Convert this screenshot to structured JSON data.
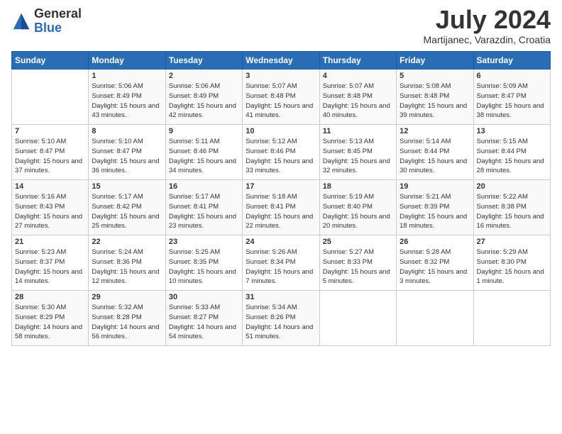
{
  "logo": {
    "general": "General",
    "blue": "Blue"
  },
  "title": "July 2024",
  "subtitle": "Martijanec, Varazdin, Croatia",
  "days_header": [
    "Sunday",
    "Monday",
    "Tuesday",
    "Wednesday",
    "Thursday",
    "Friday",
    "Saturday"
  ],
  "weeks": [
    [
      {
        "num": "",
        "sunrise": "",
        "sunset": "",
        "daylight": ""
      },
      {
        "num": "1",
        "sunrise": "Sunrise: 5:06 AM",
        "sunset": "Sunset: 8:49 PM",
        "daylight": "Daylight: 15 hours and 43 minutes."
      },
      {
        "num": "2",
        "sunrise": "Sunrise: 5:06 AM",
        "sunset": "Sunset: 8:49 PM",
        "daylight": "Daylight: 15 hours and 42 minutes."
      },
      {
        "num": "3",
        "sunrise": "Sunrise: 5:07 AM",
        "sunset": "Sunset: 8:48 PM",
        "daylight": "Daylight: 15 hours and 41 minutes."
      },
      {
        "num": "4",
        "sunrise": "Sunrise: 5:07 AM",
        "sunset": "Sunset: 8:48 PM",
        "daylight": "Daylight: 15 hours and 40 minutes."
      },
      {
        "num": "5",
        "sunrise": "Sunrise: 5:08 AM",
        "sunset": "Sunset: 8:48 PM",
        "daylight": "Daylight: 15 hours and 39 minutes."
      },
      {
        "num": "6",
        "sunrise": "Sunrise: 5:09 AM",
        "sunset": "Sunset: 8:47 PM",
        "daylight": "Daylight: 15 hours and 38 minutes."
      }
    ],
    [
      {
        "num": "7",
        "sunrise": "Sunrise: 5:10 AM",
        "sunset": "Sunset: 8:47 PM",
        "daylight": "Daylight: 15 hours and 37 minutes."
      },
      {
        "num": "8",
        "sunrise": "Sunrise: 5:10 AM",
        "sunset": "Sunset: 8:47 PM",
        "daylight": "Daylight: 15 hours and 36 minutes."
      },
      {
        "num": "9",
        "sunrise": "Sunrise: 5:11 AM",
        "sunset": "Sunset: 8:46 PM",
        "daylight": "Daylight: 15 hours and 34 minutes."
      },
      {
        "num": "10",
        "sunrise": "Sunrise: 5:12 AM",
        "sunset": "Sunset: 8:46 PM",
        "daylight": "Daylight: 15 hours and 33 minutes."
      },
      {
        "num": "11",
        "sunrise": "Sunrise: 5:13 AM",
        "sunset": "Sunset: 8:45 PM",
        "daylight": "Daylight: 15 hours and 32 minutes."
      },
      {
        "num": "12",
        "sunrise": "Sunrise: 5:14 AM",
        "sunset": "Sunset: 8:44 PM",
        "daylight": "Daylight: 15 hours and 30 minutes."
      },
      {
        "num": "13",
        "sunrise": "Sunrise: 5:15 AM",
        "sunset": "Sunset: 8:44 PM",
        "daylight": "Daylight: 15 hours and 28 minutes."
      }
    ],
    [
      {
        "num": "14",
        "sunrise": "Sunrise: 5:16 AM",
        "sunset": "Sunset: 8:43 PM",
        "daylight": "Daylight: 15 hours and 27 minutes."
      },
      {
        "num": "15",
        "sunrise": "Sunrise: 5:17 AM",
        "sunset": "Sunset: 8:42 PM",
        "daylight": "Daylight: 15 hours and 25 minutes."
      },
      {
        "num": "16",
        "sunrise": "Sunrise: 5:17 AM",
        "sunset": "Sunset: 8:41 PM",
        "daylight": "Daylight: 15 hours and 23 minutes."
      },
      {
        "num": "17",
        "sunrise": "Sunrise: 5:18 AM",
        "sunset": "Sunset: 8:41 PM",
        "daylight": "Daylight: 15 hours and 22 minutes."
      },
      {
        "num": "18",
        "sunrise": "Sunrise: 5:19 AM",
        "sunset": "Sunset: 8:40 PM",
        "daylight": "Daylight: 15 hours and 20 minutes."
      },
      {
        "num": "19",
        "sunrise": "Sunrise: 5:21 AM",
        "sunset": "Sunset: 8:39 PM",
        "daylight": "Daylight: 15 hours and 18 minutes."
      },
      {
        "num": "20",
        "sunrise": "Sunrise: 5:22 AM",
        "sunset": "Sunset: 8:38 PM",
        "daylight": "Daylight: 15 hours and 16 minutes."
      }
    ],
    [
      {
        "num": "21",
        "sunrise": "Sunrise: 5:23 AM",
        "sunset": "Sunset: 8:37 PM",
        "daylight": "Daylight: 15 hours and 14 minutes."
      },
      {
        "num": "22",
        "sunrise": "Sunrise: 5:24 AM",
        "sunset": "Sunset: 8:36 PM",
        "daylight": "Daylight: 15 hours and 12 minutes."
      },
      {
        "num": "23",
        "sunrise": "Sunrise: 5:25 AM",
        "sunset": "Sunset: 8:35 PM",
        "daylight": "Daylight: 15 hours and 10 minutes."
      },
      {
        "num": "24",
        "sunrise": "Sunrise: 5:26 AM",
        "sunset": "Sunset: 8:34 PM",
        "daylight": "Daylight: 15 hours and 7 minutes."
      },
      {
        "num": "25",
        "sunrise": "Sunrise: 5:27 AM",
        "sunset": "Sunset: 8:33 PM",
        "daylight": "Daylight: 15 hours and 5 minutes."
      },
      {
        "num": "26",
        "sunrise": "Sunrise: 5:28 AM",
        "sunset": "Sunset: 8:32 PM",
        "daylight": "Daylight: 15 hours and 3 minutes."
      },
      {
        "num": "27",
        "sunrise": "Sunrise: 5:29 AM",
        "sunset": "Sunset: 8:30 PM",
        "daylight": "Daylight: 15 hours and 1 minute."
      }
    ],
    [
      {
        "num": "28",
        "sunrise": "Sunrise: 5:30 AM",
        "sunset": "Sunset: 8:29 PM",
        "daylight": "Daylight: 14 hours and 58 minutes."
      },
      {
        "num": "29",
        "sunrise": "Sunrise: 5:32 AM",
        "sunset": "Sunset: 8:28 PM",
        "daylight": "Daylight: 14 hours and 56 minutes."
      },
      {
        "num": "30",
        "sunrise": "Sunrise: 5:33 AM",
        "sunset": "Sunset: 8:27 PM",
        "daylight": "Daylight: 14 hours and 54 minutes."
      },
      {
        "num": "31",
        "sunrise": "Sunrise: 5:34 AM",
        "sunset": "Sunset: 8:26 PM",
        "daylight": "Daylight: 14 hours and 51 minutes."
      },
      {
        "num": "",
        "sunrise": "",
        "sunset": "",
        "daylight": ""
      },
      {
        "num": "",
        "sunrise": "",
        "sunset": "",
        "daylight": ""
      },
      {
        "num": "",
        "sunrise": "",
        "sunset": "",
        "daylight": ""
      }
    ]
  ]
}
